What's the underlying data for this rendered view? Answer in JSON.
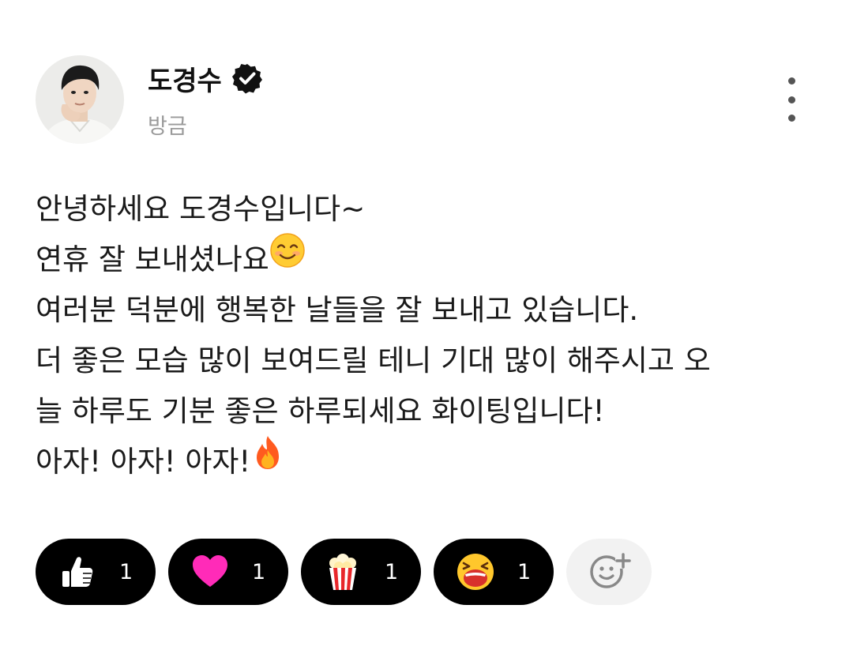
{
  "author": {
    "name": "도경수",
    "verified": true,
    "avatar_icon": "profile-photo",
    "timestamp": "방금"
  },
  "post": {
    "lines": [
      "안녕하세요 도경수입니다~",
      "연휴 잘 보내셨나요",
      "여러분 덕분에 행복한 날들을 잘 보내고 있습니다.",
      "더 좋은 모습 많이 보여드릴 테니 기대 많이 해주시고 오",
      "늘 하루도 기분 좋은 하루되세요 화이팅입니다!",
      "아자! 아자! 아자!"
    ],
    "emojis": {
      "line2": "smiling-face-emoji",
      "line6": "fire-emoji"
    }
  },
  "reactions": [
    {
      "icon": "thumbs-up-icon",
      "count": "1"
    },
    {
      "icon": "heart-icon",
      "count": "1"
    },
    {
      "icon": "popcorn-icon",
      "count": "1"
    },
    {
      "icon": "laughing-face-icon",
      "count": "1"
    }
  ],
  "actions": {
    "more_icon": "more-vertical-icon",
    "add_reaction_icon": "add-reaction-icon"
  },
  "colors": {
    "pill_bg": "#000000",
    "heart": "#ff2bb8",
    "timestamp": "#9a9a9a",
    "add_reaction_bg": "#f2f2f2"
  }
}
